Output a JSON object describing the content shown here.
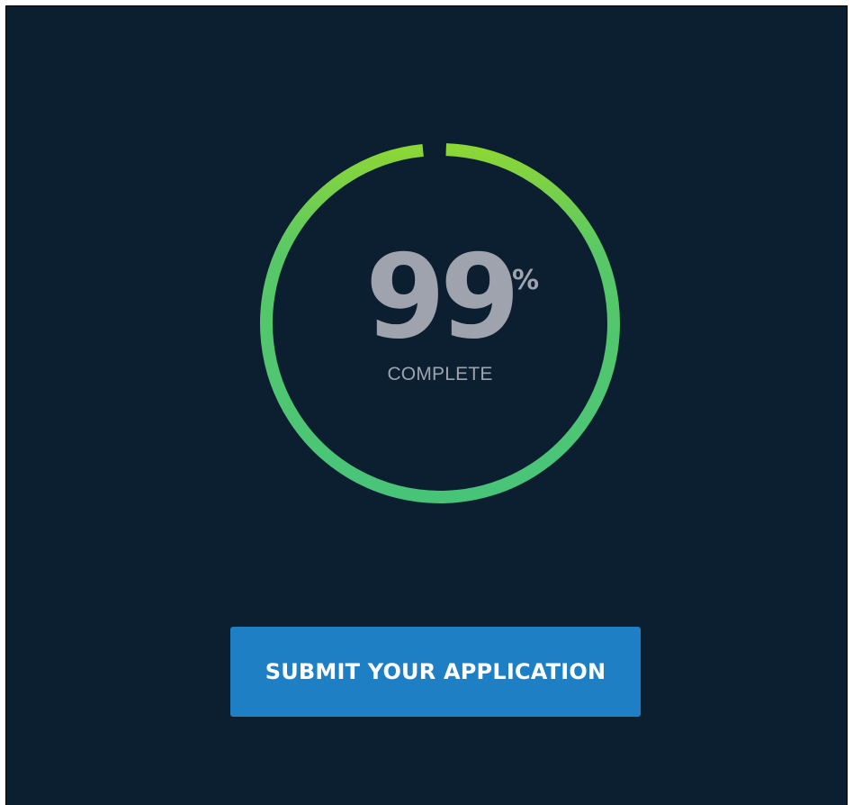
{
  "progress": {
    "value": "99",
    "unit": "%",
    "caption": "COMPLETE",
    "fraction": 0.99,
    "colors": {
      "start": "#8cd636",
      "end": "#48c479",
      "track": "#0b1f30"
    }
  },
  "actions": {
    "submit_label": "SUBMIT YOUR APPLICATION"
  },
  "theme": {
    "background": "#0b1f30",
    "button": "#1f7fc4",
    "text_muted": "#9ea3ae"
  }
}
